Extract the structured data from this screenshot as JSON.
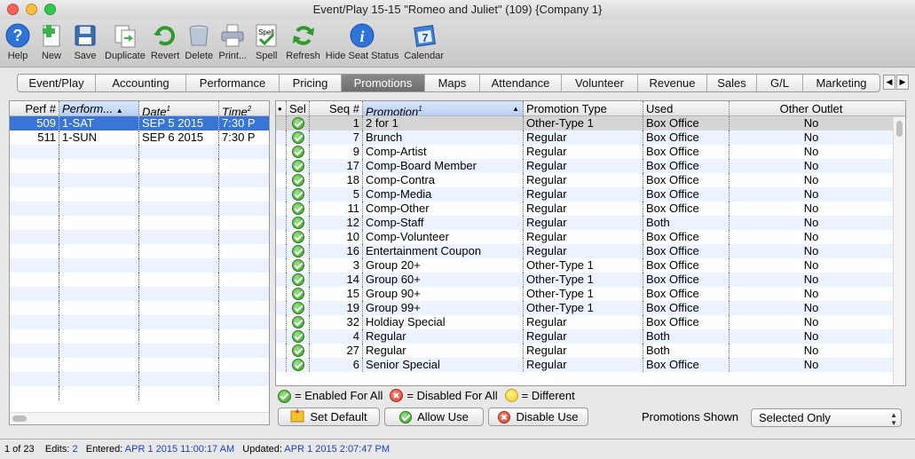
{
  "window": {
    "title": "Event/Play 15-15 \"Romeo and Juliet\" (109) {Company 1}"
  },
  "toolbar": [
    {
      "label": "Help",
      "icon": "help-icon"
    },
    {
      "label": "New",
      "icon": "new-icon"
    },
    {
      "label": "Save",
      "icon": "save-icon"
    },
    {
      "label": "Duplicate",
      "icon": "duplicate-icon"
    },
    {
      "label": "Revert",
      "icon": "revert-icon"
    },
    {
      "label": "Delete",
      "icon": "delete-icon"
    },
    {
      "label": "Print...",
      "icon": "print-icon"
    },
    {
      "label": "Spell",
      "icon": "spell-icon",
      "badge": "Spell"
    },
    {
      "label": "Refresh",
      "icon": "refresh-icon"
    },
    {
      "label": "Hide Seat Status",
      "icon": "info-icon"
    },
    {
      "label": "Calendar",
      "icon": "calendar-icon",
      "badge": "7"
    }
  ],
  "tabs": [
    {
      "label": "Event/Play"
    },
    {
      "label": "Accounting"
    },
    {
      "label": "Performance"
    },
    {
      "label": "Pricing"
    },
    {
      "label": "Promotions",
      "active": true
    },
    {
      "label": "Maps"
    },
    {
      "label": "Attendance"
    },
    {
      "label": "Volunteer"
    },
    {
      "label": "Revenue"
    },
    {
      "label": "Sales"
    },
    {
      "label": "G/L"
    },
    {
      "label": "Marketing"
    }
  ],
  "performances": {
    "columns": [
      "Perf #",
      "Perform...",
      "Date",
      "Time"
    ],
    "column_superscripts": {
      "date": "1",
      "time": "2"
    },
    "rows": [
      {
        "perf": "509",
        "performance": "1-SAT",
        "date": "SEP 5 2015",
        "time": "7:30 P",
        "selected": true
      },
      {
        "perf": "511",
        "performance": "1-SUN",
        "date": "SEP 6 2015",
        "time": "7:30 P"
      }
    ]
  },
  "promotions": {
    "columns": [
      "•",
      "Sel",
      "Seq #",
      "Promotion",
      "Promotion Type",
      "Used",
      "Other Outlet"
    ],
    "promotion_superscript": "1",
    "rows": [
      {
        "seq": "1",
        "name": "2 for 1",
        "type": "Other-Type 1",
        "used": "Box Office",
        "other": "No"
      },
      {
        "seq": "7",
        "name": "Brunch",
        "type": "Regular",
        "used": "Box Office",
        "other": "No"
      },
      {
        "seq": "9",
        "name": "Comp-Artist",
        "type": "Regular",
        "used": "Box Office",
        "other": "No"
      },
      {
        "seq": "17",
        "name": "Comp-Board Member",
        "type": "Regular",
        "used": "Box Office",
        "other": "No"
      },
      {
        "seq": "18",
        "name": "Comp-Contra",
        "type": "Regular",
        "used": "Box Office",
        "other": "No"
      },
      {
        "seq": "5",
        "name": "Comp-Media",
        "type": "Regular",
        "used": "Box Office",
        "other": "No"
      },
      {
        "seq": "11",
        "name": "Comp-Other",
        "type": "Regular",
        "used": "Box Office",
        "other": "No"
      },
      {
        "seq": "12",
        "name": "Comp-Staff",
        "type": "Regular",
        "used": "Both",
        "other": "No"
      },
      {
        "seq": "10",
        "name": "Comp-Volunteer",
        "type": "Regular",
        "used": "Box Office",
        "other": "No"
      },
      {
        "seq": "16",
        "name": "Entertainment Coupon",
        "type": "Regular",
        "used": "Box Office",
        "other": "No"
      },
      {
        "seq": "3",
        "name": "Group 20+",
        "type": "Other-Type 1",
        "used": "Box Office",
        "other": "No"
      },
      {
        "seq": "14",
        "name": "Group 60+",
        "type": "Other-Type 1",
        "used": "Box Office",
        "other": "No"
      },
      {
        "seq": "15",
        "name": "Group 90+",
        "type": "Other-Type 1",
        "used": "Box Office",
        "other": "No"
      },
      {
        "seq": "19",
        "name": "Group 99+",
        "type": "Other-Type 1",
        "used": "Box Office",
        "other": "No"
      },
      {
        "seq": "32",
        "name": "Holdiay Special",
        "type": "Regular",
        "used": "Box Office",
        "other": "No"
      },
      {
        "seq": "4",
        "name": "Regular",
        "type": "Regular",
        "used": "Both",
        "other": "No"
      },
      {
        "seq": "27",
        "name": "Regular",
        "type": "Regular",
        "used": "Both",
        "other": "No"
      },
      {
        "seq": "6",
        "name": "Senior Special",
        "type": "Regular",
        "used": "Box Office",
        "other": "No"
      }
    ]
  },
  "legend": {
    "enabled": "= Enabled For All",
    "disabled": "= Disabled For All",
    "different": "= Different"
  },
  "buttons": {
    "set_default": "Set Default",
    "allow_use": "Allow Use",
    "disable_use": "Disable Use"
  },
  "promotions_shown": {
    "label": "Promotions Shown",
    "value": "Selected Only"
  },
  "status": {
    "record": "1 of 23",
    "edits_label": "Edits:",
    "edits": "2",
    "entered_label": "Entered:",
    "entered": "APR 1 2015 11:00:17 AM",
    "updated_label": "Updated:",
    "updated": "APR 1 2015 2:07:47 PM"
  },
  "colors": {
    "selection": "#3875d7",
    "active_tab": "#6e6e6e",
    "status_value": "#1a3fc4",
    "enabled": "#2f9a1f",
    "disabled": "#d93a2a",
    "different": "#f2c81b"
  }
}
